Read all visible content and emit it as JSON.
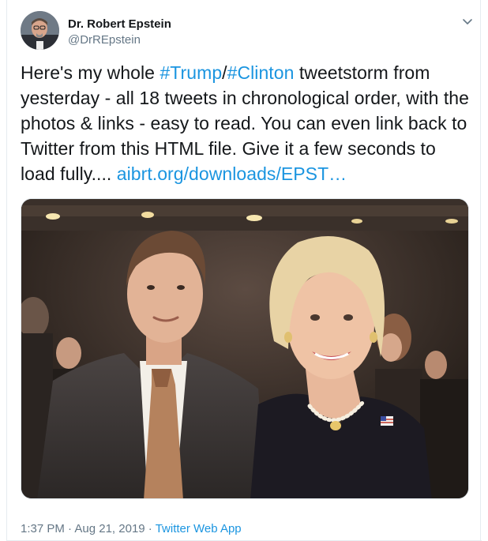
{
  "author": {
    "name": "Dr. Robert Epstein",
    "handle": "@DrREpstein"
  },
  "tweet": {
    "part1": "Here's my whole ",
    "hashtag1": "#Trump",
    "sep": "/",
    "hashtag2": "#Clinton",
    "part2": " tweetstorm from yesterday - all 18 tweets in chronological order, with the photos & links - easy to read. You can even link back to Twitter from this HTML file. Give it a few seconds to load fully.... ",
    "link": "aibrt.org/downloads/EPST…"
  },
  "meta": {
    "time": "1:37 PM",
    "dot1": " · ",
    "date": "Aug 21, 2019",
    "dot2": " · ",
    "source": "Twitter Web App"
  },
  "icons": {
    "caret": "chevron-down-icon"
  },
  "colors": {
    "link": "#1b95e0",
    "text": "#14171a",
    "secondary": "#657786"
  }
}
